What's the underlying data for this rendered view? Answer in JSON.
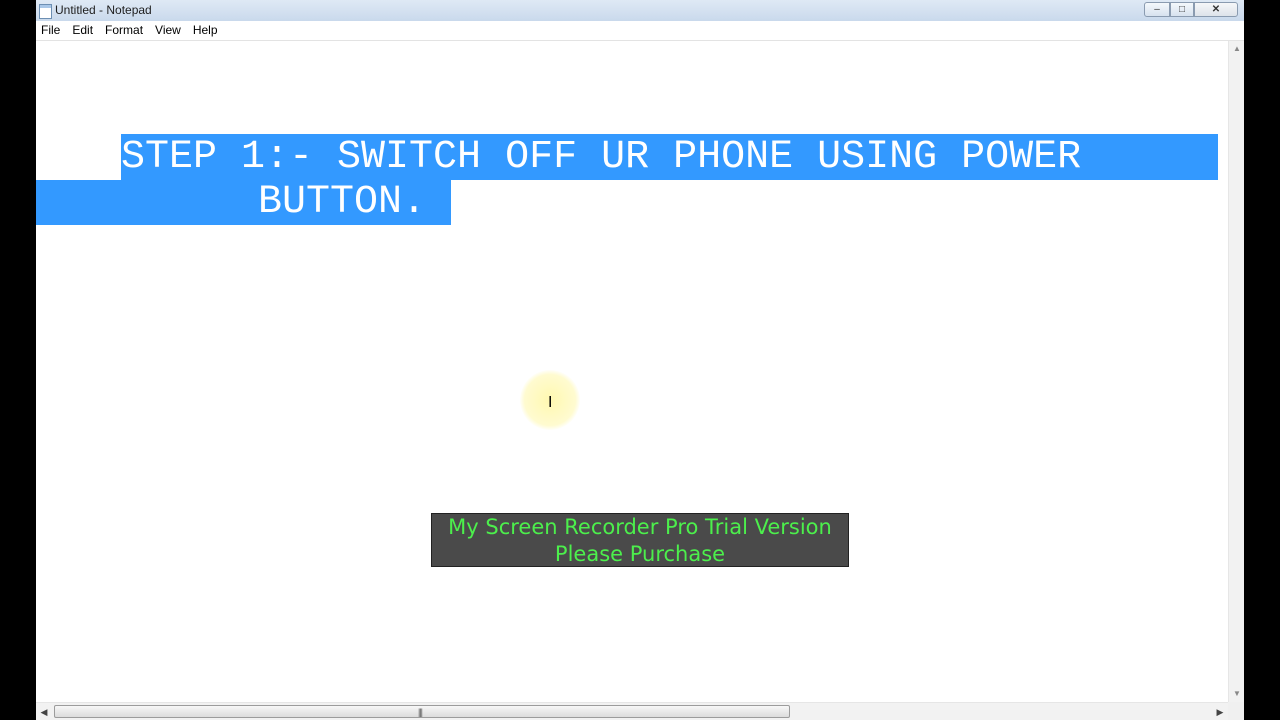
{
  "window": {
    "title": "Untitled - Notepad",
    "background_tabs": [
      "",
      ""
    ],
    "controls": {
      "minimize": "–",
      "maximize": "□",
      "close": "✕"
    }
  },
  "menu": {
    "items": [
      "File",
      "Edit",
      "Format",
      "View",
      "Help"
    ]
  },
  "editor": {
    "line1": "STEP 1:- SWITCH OFF UR PHONE USING POWER",
    "line2": "BUTTON.",
    "selection_color": "#3399ff",
    "cursor_icon": "i-beam-cursor-icon"
  },
  "watermark": {
    "line1": "My Screen Recorder Pro Trial Version",
    "line2": "Please Purchase",
    "text_color": "#4cef4c",
    "background": "#4a4a4a"
  },
  "scrollbars": {
    "up_arrow": "▲",
    "down_arrow": "▼",
    "left_arrow": "◀",
    "right_arrow": "▶",
    "grip": "|||"
  }
}
